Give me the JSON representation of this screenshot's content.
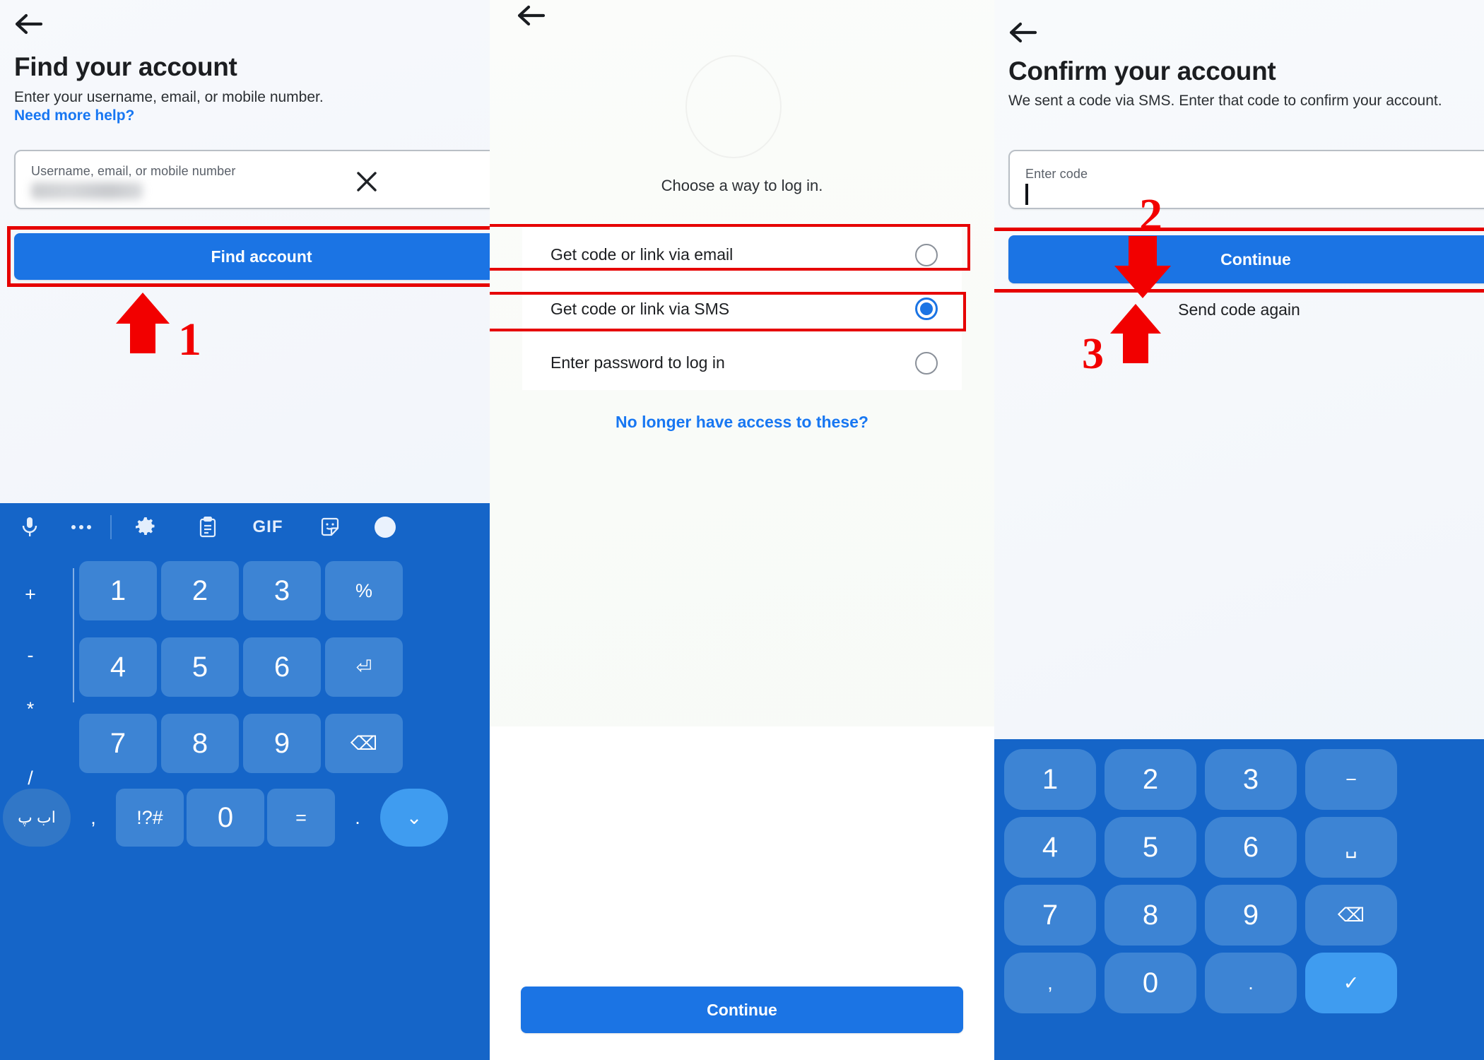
{
  "colors": {
    "brand_blue": "#1b74e4",
    "link_blue": "#1877f2",
    "annotation_red": "#e60000",
    "keyboard_blue": "#1565c8",
    "key_blue": "#3d84d4"
  },
  "panel1": {
    "back_icon": "back-arrow-icon",
    "title": "Find your account",
    "subtitle": "Enter your username, email, or mobile number.",
    "help_link": "Need more help?",
    "input": {
      "label": "Username, email, or mobile number",
      "value": "",
      "clear_icon": "close-x-icon"
    },
    "primary_button": "Find account",
    "annotation_number": "1"
  },
  "panel2": {
    "back_icon": "back-arrow-icon",
    "choose_label": "Choose a way to log in.",
    "options": [
      {
        "label": "Get code or link via email",
        "selected": false
      },
      {
        "label": "Get code or link via SMS",
        "selected": true
      },
      {
        "label": "Enter password to log in",
        "selected": false
      }
    ],
    "no_access_link": "No longer have access to these?",
    "primary_button": "Continue",
    "annotation_number": "2"
  },
  "panel3": {
    "back_icon": "back-arrow-icon",
    "title": "Confirm your account",
    "subtitle": "We sent a code via SMS. Enter that code to confirm your account.",
    "input": {
      "label": "Enter code",
      "value": ""
    },
    "primary_button": "Continue",
    "resend_link": "Send code again",
    "annotation_number": "3"
  },
  "keyboard1": {
    "toolbar_icons": [
      "microphone-icon",
      "more-options-icon",
      "gear-icon",
      "clipboard-icon",
      "gif-icon",
      "sticker-icon"
    ],
    "gif_label": "GIF",
    "left_column": [
      "+",
      "-",
      "*",
      "/"
    ],
    "lang_key": "اب پ",
    "keys": {
      "r1": [
        "1",
        "2",
        "3"
      ],
      "r1_right": "%",
      "r2": [
        "4",
        "5",
        "6"
      ],
      "r2_right": "enter-icon",
      "r3": [
        "7",
        "8",
        "9"
      ],
      "r3_right": "backspace-icon",
      "r4": [
        ",",
        "!?#",
        "0",
        "=",
        "."
      ],
      "r4_right": "chevron-down-icon"
    }
  },
  "keyboard3": {
    "rows": [
      [
        "1",
        "2",
        "3",
        "−"
      ],
      [
        "4",
        "5",
        "6",
        "space-icon"
      ],
      [
        "7",
        "8",
        "9",
        "backspace-icon"
      ],
      [
        ",",
        "0",
        ".",
        "check-icon"
      ]
    ]
  }
}
